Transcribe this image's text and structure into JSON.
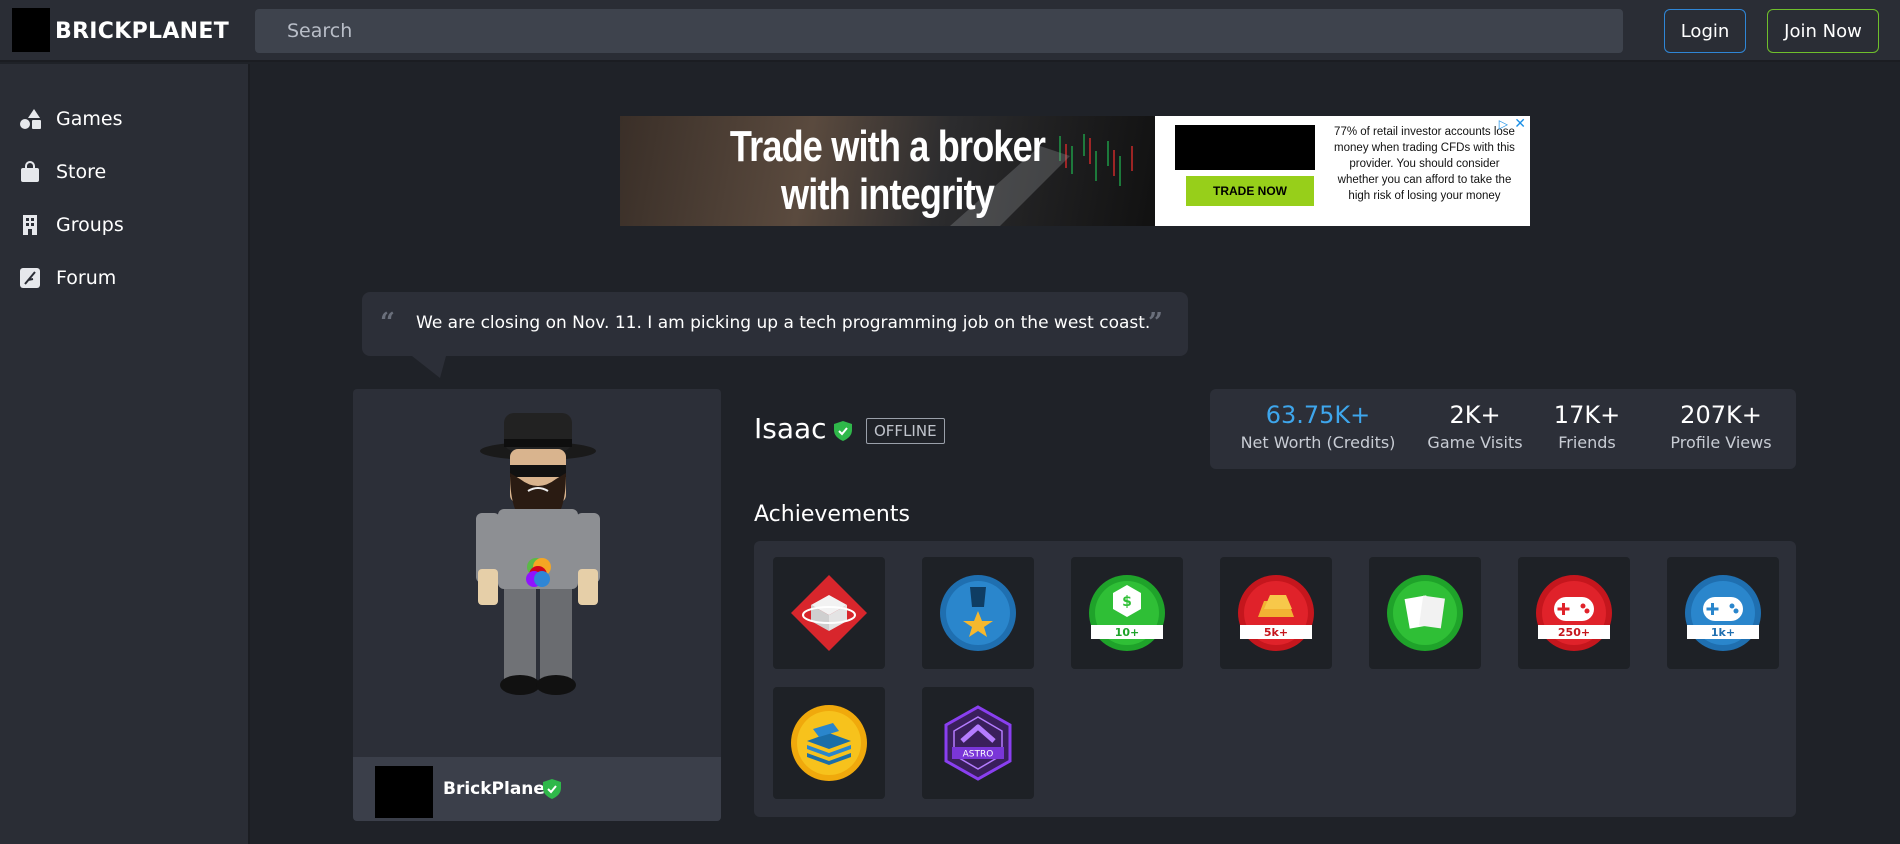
{
  "header": {
    "brand": "BRICKPLANET",
    "search_placeholder": "Search",
    "login_label": "Login",
    "join_label": "Join Now"
  },
  "sidebar": {
    "items": [
      {
        "label": "Games",
        "icon": "shapes-icon"
      },
      {
        "label": "Store",
        "icon": "shopping-bag-icon"
      },
      {
        "label": "Groups",
        "icon": "building-icon"
      },
      {
        "label": "Forum",
        "icon": "feather-icon"
      }
    ]
  },
  "ad": {
    "headline_1": "Trade with a broker",
    "headline_2": "with integrity",
    "cta": "TRADE NOW",
    "disclaimer": "77% of retail investor accounts lose money when trading CFDs with this provider. You should consider whether you can afford to take the high risk of losing your money"
  },
  "profile": {
    "status_quote": "We are closing on Nov. 11. I am picking up a tech programming job on the west coast.",
    "username": "Isaac",
    "online_status": "OFFLINE",
    "owner_name": "BrickPlanet",
    "verified_color": "#2fb84a"
  },
  "stats": [
    {
      "value": "63.75K+",
      "label": "Net Worth (Credits)"
    },
    {
      "value": "2K+",
      "label": "Game Visits"
    },
    {
      "value": "17K+",
      "label": "Friends"
    },
    {
      "value": "207K+",
      "label": "Profile Views"
    }
  ],
  "achievements": {
    "title": "Achievements",
    "badges": [
      {
        "name": "builder-badge-icon",
        "text": ""
      },
      {
        "name": "medal-badge-icon",
        "text": ""
      },
      {
        "name": "credits-10-badge-icon",
        "text": "10+"
      },
      {
        "name": "gold-5k-badge-icon",
        "text": "5k+"
      },
      {
        "name": "forum-posts-badge-icon",
        "text": ""
      },
      {
        "name": "games-250-badge-icon",
        "text": "250+"
      },
      {
        "name": "games-1k-badge-icon",
        "text": "1k+"
      },
      {
        "name": "stack-badge-icon",
        "text": ""
      },
      {
        "name": "astro-badge-icon",
        "text": "ASTRO"
      }
    ]
  }
}
